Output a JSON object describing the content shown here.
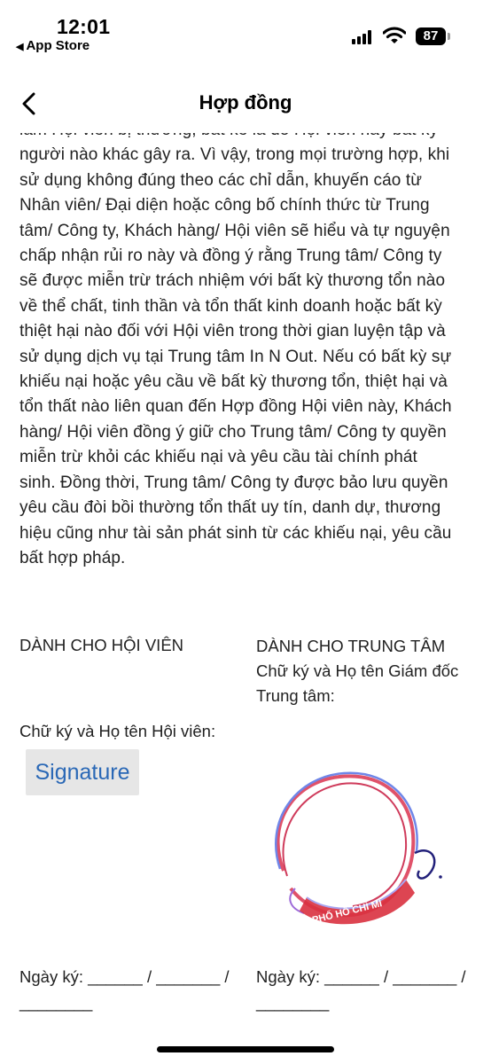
{
  "status_bar": {
    "time": "12:01",
    "back_app": "App Store",
    "battery": "87"
  },
  "header": {
    "title": "Hợp đồng"
  },
  "contract": {
    "lines": [
      "làm Hội viên bị thương, bất kể là do Hội viên hay bất kỳ",
      "người nào khác gây ra. Vì vậy, trong mọi trường hợp, khi",
      "sử dụng không đúng theo các chỉ dẫn, khuyến cáo từ",
      "Nhân viên/ Đại diện hoặc công bố chính thức từ Trung",
      "tâm/ Công ty, Khách hàng/ Hội viên sẽ hiểu và tự nguyện",
      "chấp nhận rủi ro này và đồng ý rằng Trung tâm/ Công ty",
      "sẽ được miễn trừ trách nhiệm với bất kỳ thương tổn nào",
      "về thể chất, tinh thần và tổn thất kinh doanh hoặc bất kỳ",
      "thiệt hại nào đối với Hội viên trong thời gian luyện tập và",
      "sử dụng dịch vụ tại Trung tâm In N Out. Nếu có bất kỳ sự",
      "khiếu nại hoặc yêu cầu về bất kỳ thương tổn, thiệt hại và",
      "tổn thất nào liên quan đến Hợp đồng Hội viên này, Khách",
      "hàng/ Hội viên đồng ý giữ cho Trung tâm/ Công ty quyền",
      "miễn trừ khỏi các khiếu nại và yêu cầu tài chính phát",
      "sinh. Đồng thời, Trung tâm/ Công ty được bảo lưu quyền",
      "yêu cầu đòi bồi thường tổn thất uy tín, danh dự, thương",
      "hiệu cũng như tài sản phát sinh từ các khiếu nại, yêu cầu",
      "bất hợp pháp."
    ]
  },
  "member": {
    "heading": "DÀNH CHO HỘI VIÊN",
    "signature_label": "Chữ ký và Họ tên Hội viên:",
    "signature_button": "Signature",
    "date_line1": "Ngày ký: ______ / _______ /",
    "date_line2": "________"
  },
  "center": {
    "heading": "DÀNH CHO TRUNG TÂM",
    "signature_label_line1": "Chữ ký và Họ tên Giám đốc",
    "signature_label_line2": "Trung tâm:",
    "stamp_text": "PHỐ HỒ CHÍ MI",
    "date_line1": "Ngày ký: ______ / _______ /",
    "date_line2": "________"
  }
}
